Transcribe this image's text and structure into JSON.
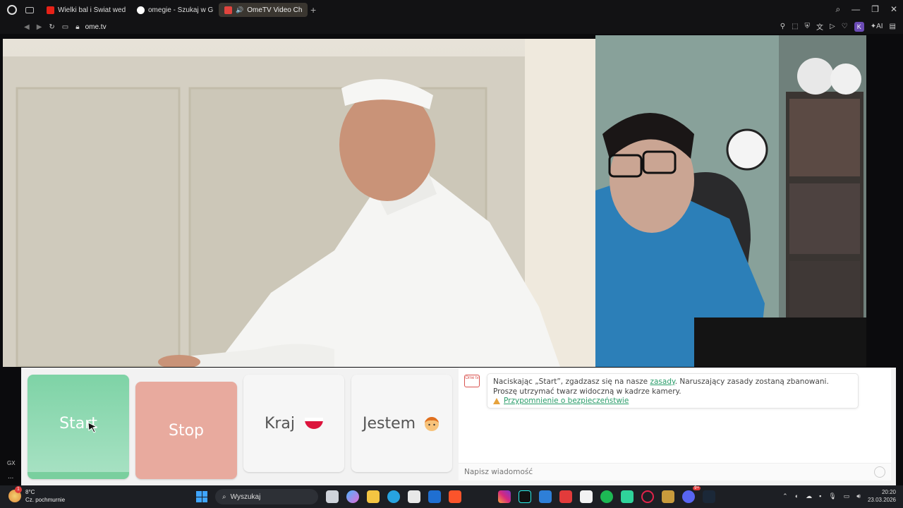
{
  "browser": {
    "tabs": [
      {
        "label": "Wielki bal i Świat według K",
        "favicon_color": "#e62117",
        "active": false
      },
      {
        "label": "omegie - Szukaj w Google",
        "favicon_color": "#ffffff",
        "active": false
      },
      {
        "label": "OmeTV Video Chat —",
        "favicon_color": "#e0443e",
        "active": true
      }
    ],
    "url": "ome.tv",
    "ai_label": "AI",
    "profile_letter": "K"
  },
  "sidebar": {
    "gx_label": "GX",
    "more_label": "..."
  },
  "controls": {
    "start_label": "Start",
    "stop_label": "Stop",
    "country_label": "Kraj",
    "gender_label": "Jestem"
  },
  "chat": {
    "logo_text": "Ome tv",
    "notice_before_link": "Naciskając „Start”, zgadzasz się na nasze ",
    "notice_link": "zasady",
    "notice_after_link": ". Naruszający zasady zostaną zbanowani. Proszę utrzymać twarz widoczną w kadrze kamery.",
    "safety_link": "Przypomnienie o bezpieczeństwie",
    "input_placeholder": "Napisz wiadomość"
  },
  "taskbar": {
    "temperature": "8°C",
    "weather": "Cz. pochmurnie",
    "search_placeholder": "Wyszukaj",
    "time": "20:20",
    "date": "23.03.2026",
    "notification_badge": "1",
    "discord_badge": "9+"
  }
}
